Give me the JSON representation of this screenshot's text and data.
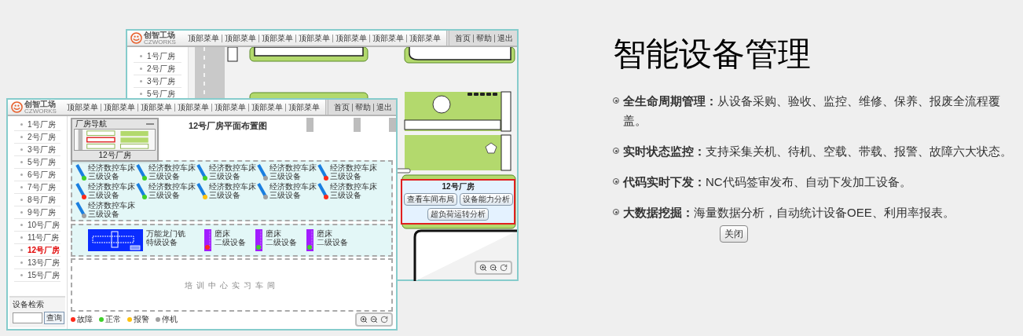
{
  "back_window": {
    "logo": {
      "name": "创智工场",
      "sub": "CZWORKS"
    },
    "menu": [
      "顶部菜单",
      "顶部菜单",
      "顶部菜单",
      "顶部菜单",
      "顶部菜单",
      "顶部菜单",
      "顶部菜单"
    ],
    "links": [
      "首页",
      "帮助",
      "退出"
    ],
    "sidebar": [
      {
        "label": "1号厂房",
        "selected": false
      },
      {
        "label": "2号厂房",
        "selected": false
      },
      {
        "label": "3号厂房",
        "selected": false
      },
      {
        "label": "5号厂房",
        "selected": false
      }
    ],
    "popup": {
      "title": "12号厂房",
      "buttons": [
        "查看车间布局",
        "设备能力分析",
        "超负荷运转分析"
      ]
    }
  },
  "front_window": {
    "logo": {
      "name": "创智工场",
      "sub": "CZWORKS"
    },
    "menu": [
      "顶部菜单",
      "顶部菜单",
      "顶部菜单",
      "顶部菜单",
      "顶部菜单",
      "顶部菜单",
      "顶部菜单"
    ],
    "links": [
      "首页",
      "帮助",
      "退出"
    ],
    "sidebar": [
      {
        "label": "1号厂房",
        "selected": false
      },
      {
        "label": "2号厂房",
        "selected": false
      },
      {
        "label": "3号厂房",
        "selected": false
      },
      {
        "label": "5号厂房",
        "selected": false
      },
      {
        "label": "6号厂房",
        "selected": false
      },
      {
        "label": "7号厂房",
        "selected": false
      },
      {
        "label": "8号厂房",
        "selected": false
      },
      {
        "label": "9号厂房",
        "selected": false
      },
      {
        "label": "10号厂房",
        "selected": false
      },
      {
        "label": "11号厂房",
        "selected": false
      },
      {
        "label": "12号厂房",
        "selected": true
      },
      {
        "label": "13号厂房",
        "selected": false
      },
      {
        "label": "15号厂房",
        "selected": false
      }
    ],
    "search": {
      "title": "设备检索",
      "button": "查询"
    },
    "nav_panel": {
      "title": "厂房导航",
      "caption": "12号厂房"
    },
    "map": {
      "title": "12号厂房平面布置图",
      "devices": [
        {
          "name": "经济数控车床",
          "grade": "三级设备",
          "color": "#3fd12a"
        },
        {
          "name": "经济数控车床",
          "grade": "三级设备",
          "color": "#3fd12a"
        },
        {
          "name": "经济数控车床",
          "grade": "三级设备",
          "color": "#3fd12a"
        },
        {
          "name": "经济数控车床",
          "grade": "三级设备",
          "color": "#a0a0a0"
        },
        {
          "name": "经济数控车床",
          "grade": "三级设备",
          "color": "#ff2a1a"
        },
        {
          "name": "经济数控车床",
          "grade": "三级设备",
          "color": "#ff2a1a"
        },
        {
          "name": "经济数控车床",
          "grade": "三级设备",
          "color": "#3fd12a"
        },
        {
          "name": "经济数控车床",
          "grade": "三级设备",
          "color": "#ffc20e"
        },
        {
          "name": "经济数控车床",
          "grade": "三级设备",
          "color": "#a0a0a0"
        },
        {
          "name": "经济数控车床",
          "grade": "三级设备",
          "color": "#ff2a1a"
        },
        {
          "name": "经济数控车床",
          "grade": "三级设备",
          "color": "#a0a0a0"
        }
      ],
      "special_devices": [
        {
          "kind": "gantry",
          "name": "万能龙门铣",
          "grade": "特级设备"
        },
        {
          "kind": "grinder",
          "name": "磨床",
          "grade": "二级设备",
          "color": "#ff2a1a"
        },
        {
          "kind": "grinder",
          "name": "磨床",
          "grade": "二级设备",
          "color": "#3fd12a"
        },
        {
          "kind": "grinder",
          "name": "磨床",
          "grade": "二级设备",
          "color": "#3fd12a"
        }
      ],
      "training_area": "培训中心实习车间",
      "legend": [
        {
          "label": "故障",
          "color": "#ff2a1a"
        },
        {
          "label": "正常",
          "color": "#3fd12a"
        },
        {
          "label": "报警",
          "color": "#ffc20e"
        },
        {
          "label": "停机",
          "color": "#a0a0a0"
        }
      ]
    }
  },
  "info": {
    "title": "智能设备管理",
    "points": [
      "**全生命周期管理：**从设备采购、验收、监控、维修、保养、报废全流程覆盖。",
      "**实时状态监控：**支持采集关机、待机、空载、带载、报警、故障六大状态。",
      "**代码实时下发：**NC代码签审发布、自动下发加工设备。",
      "**大数据挖掘：**海量数据分析，自动统计设备OEE、利用率报表。"
    ],
    "close_button": "关闭"
  }
}
